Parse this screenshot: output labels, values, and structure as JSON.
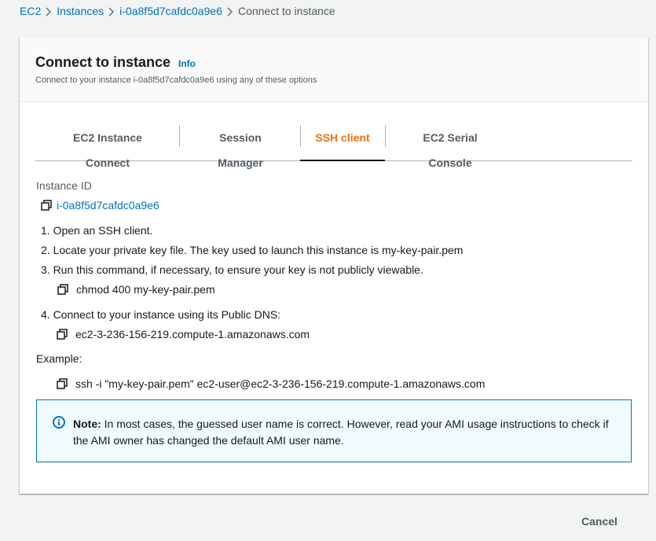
{
  "breadcrumb": {
    "items": [
      "EC2",
      "Instances",
      "i-0a8f5d7cafdc0a9e6"
    ],
    "current": "Connect to instance"
  },
  "panel": {
    "title": "Connect to instance",
    "info": "Info",
    "description": "Connect to your instance i-0a8f5d7cafdc0a9e6 using any of these options"
  },
  "tabs": [
    {
      "label": "EC2 Instance Connect",
      "active": false
    },
    {
      "label": "Session Manager",
      "active": false
    },
    {
      "label": "SSH client",
      "active": true
    },
    {
      "label": "EC2 Serial Console",
      "active": false
    }
  ],
  "instance": {
    "label": "Instance ID",
    "id": "i-0a8f5d7cafdc0a9e6"
  },
  "steps": [
    "1. Open an SSH client.",
    "2. Locate your private key file. The key used to launch this instance is my-key-pair.pem",
    "3. Run this command, if necessary, to ensure your key is not publicly viewable.",
    "4. Connect to your instance using its Public DNS:"
  ],
  "commands": {
    "chmod": "chmod 400 my-key-pair.pem",
    "dns": "ec2-3-236-156-219.compute-1.amazonaws.com",
    "example_label": "Example:",
    "ssh": "ssh -i \"my-key-pair.pem\" ec2-user@ec2-3-236-156-219.compute-1.amazonaws.com"
  },
  "alert": {
    "title": "Note:",
    "body": " In most cases, the guessed user name is correct. However, read your AMI usage instructions to check if the AMI owner has changed the default AMI user name."
  },
  "footer": {
    "cancel": "Cancel"
  },
  "colors": {
    "link": "#0073bb",
    "active_tab": "#ec7211",
    "alert_bg": "#f1faff"
  }
}
